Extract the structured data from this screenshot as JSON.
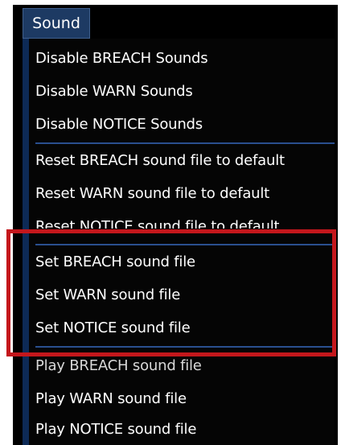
{
  "menu": {
    "title": "Sound",
    "groups": [
      {
        "items": [
          "Disable BREACH Sounds",
          "Disable WARN Sounds",
          "Disable NOTICE Sounds"
        ]
      },
      {
        "items": [
          "Reset BREACH sound file to default",
          "Reset WARN sound file to default",
          "Reset NOTICE sound file to default"
        ]
      },
      {
        "items": [
          "Set BREACH sound file",
          "Set WARN sound file",
          "Set NOTICE sound file"
        ]
      },
      {
        "items": [
          "Play BREACH sound file",
          "Play WARN sound file",
          "Play NOTICE sound file"
        ]
      }
    ]
  },
  "highlight": {
    "color": "#c4171c",
    "group": "Set sound file items"
  },
  "colors": {
    "menu_background": "#050505",
    "header_background": "#1d3a63",
    "separator": "#2a4f8f",
    "text": "#ffffff"
  }
}
